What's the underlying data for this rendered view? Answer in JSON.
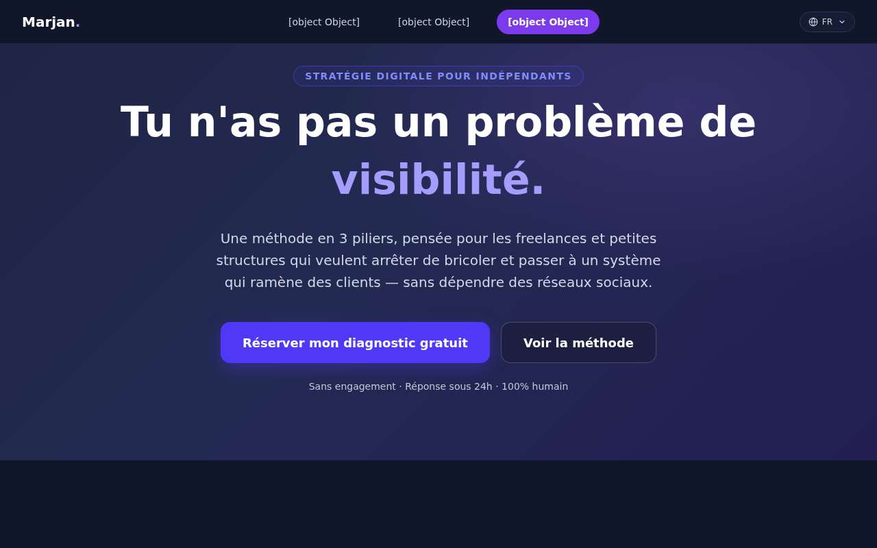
{
  "nav": {
    "logo": {
      "name": "Marjan",
      "mark": "."
    },
    "links": [
      {
        "label": "[object Object]",
        "selected": false
      },
      {
        "label": "[object Object]",
        "selected": false
      },
      {
        "label": "[object Object]",
        "selected": true
      }
    ],
    "language": {
      "label": "FR"
    }
  },
  "hero": {
    "badge": "STRATÉGIE DIGITALE POUR INDÉPENDANTS",
    "title": {
      "text": "Tu n'as pas un problème de",
      "highlight": "visibilité."
    },
    "description": "Une méthode en 3 piliers, pensée pour les freelances et petites structures qui veulent arrêter de bricoler et passer à un système qui ramène des clients — sans dépendre des réseaux sociaux.",
    "buttons": [
      {
        "label": "Réserver mon diagnostic gratuit",
        "kind": "primary"
      },
      {
        "label": "Voir la méthode",
        "kind": "secondary"
      }
    ],
    "note": "Sans engagement · Réponse sous 24h · 100% humain"
  }
}
